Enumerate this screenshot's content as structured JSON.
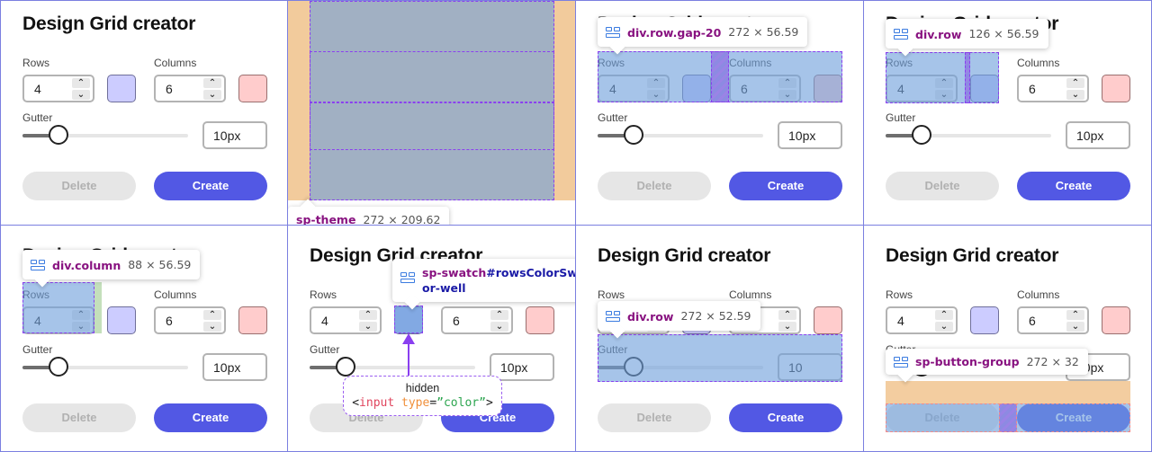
{
  "app": {
    "title": "Design Grid creator",
    "rows_label": "Rows",
    "columns_label": "Columns",
    "rows_value": "4",
    "columns_value": "6",
    "gutter_label": "Gutter",
    "gutter_value": "10px",
    "gutter_value_inspected": "10",
    "gutter_slider_fraction": 0.22,
    "rows_color": "#ccccff",
    "columns_color": "#ffcccc",
    "accent_color": "#5258e4",
    "delete_label": "Delete",
    "create_label": "Create",
    "step_up_icon": "chevron-up-icon",
    "step_down_icon": "chevron-down-icon"
  },
  "panels": [
    {
      "id": "plain",
      "tooltip": null
    },
    {
      "id": "sp-theme",
      "tooltip": {
        "tag": "sp-theme",
        "cls": "",
        "dims": "272 × 209.62"
      }
    },
    {
      "id": "row-gap",
      "tooltip": {
        "tag": "div",
        "cls": ".row.gap-20",
        "dims": "272 × 56.59"
      }
    },
    {
      "id": "row-rows",
      "tooltip": {
        "tag": "div",
        "cls": ".row",
        "dims": "126 × 56.59"
      }
    },
    {
      "id": "column",
      "tooltip": {
        "tag": "div",
        "cls": ".column",
        "dims": "88 × 56.59"
      }
    },
    {
      "id": "swatch",
      "tooltip": {
        "tag": "sp-swatch",
        "cls": "#rowsColorSwatch-color-well",
        "cls_line1": "#rowsColorSwatc",
        "cls_line2": "or-well",
        "dims": ""
      },
      "note": {
        "title": "hidden",
        "code_open": "<",
        "code_tag": "input",
        "code_attr": "type",
        "code_eq": "=",
        "code_str": "”color”",
        "code_close": ">"
      }
    },
    {
      "id": "gutter-row",
      "tooltip": {
        "tag": "div",
        "cls": ".row",
        "dims": "272 × 52.59"
      }
    },
    {
      "id": "button-group",
      "tooltip": {
        "tag": "sp-button-group",
        "cls": "",
        "dims": "272 × 32"
      }
    }
  ]
}
